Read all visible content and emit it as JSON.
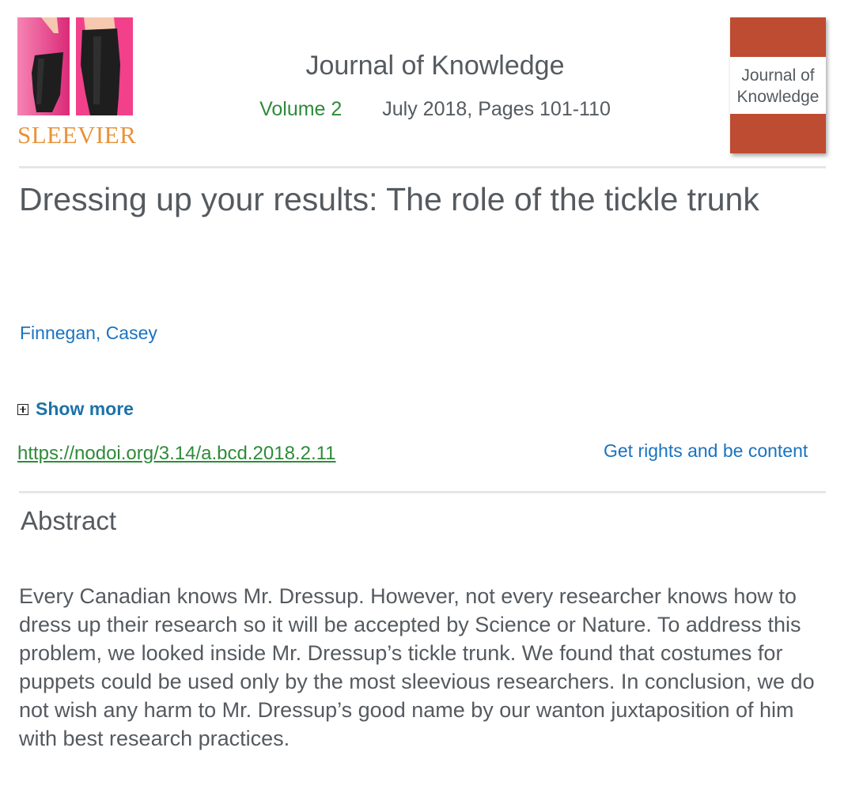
{
  "publisher": {
    "logo_text": "SLEEVIER",
    "logo_image": "sleeve-photo",
    "logo_colors": {
      "text": "#e9933a",
      "background": "#f2418a",
      "sleeve": "#222222"
    }
  },
  "journal": {
    "title": "Journal of Knowledge",
    "volume": "Volume 2",
    "issue_date": "July 2018, Pages 101-110",
    "cover_title": "Journal of Knowledge",
    "cover_color": "#bd4c32"
  },
  "article": {
    "title": "Dressing up your results: The role of the tickle trunk",
    "author": "Finnegan, Casey",
    "show_more_label": "Show more",
    "doi": "https://nodoi.org/3.14/a.bcd.2018.2.11",
    "rights_label": "Get rights and be content"
  },
  "abstract": {
    "heading": "Abstract",
    "text": "Every Canadian knows Mr. Dressup. However, not every researcher knows how to dress up their research so it will be accepted by Science or Nature. To address this problem, we looked inside Mr. Dressup’s tickle trunk. We found that costumes for puppets could be used only by the most sleevious researchers. In conclusion, we do not wish any harm to Mr. Dressup’s good name by our wanton juxtaposition of him with best research practices."
  },
  "colors": {
    "text": "#555a5f",
    "link_blue": "#1a73c0",
    "show_more_blue": "#1d72a8",
    "green": "#2e8b3a",
    "divider": "#e6e6e6"
  }
}
